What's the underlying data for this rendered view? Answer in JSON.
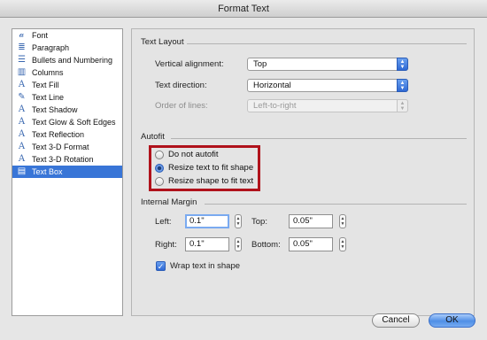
{
  "window": {
    "title": "Format Text"
  },
  "sidebar": {
    "items": [
      {
        "label": "Font",
        "icon": "font-icon",
        "glyph": "𝒶"
      },
      {
        "label": "Paragraph",
        "icon": "paragraph-icon",
        "glyph": "≣"
      },
      {
        "label": "Bullets and Numbering",
        "icon": "bullets-icon",
        "glyph": "☰"
      },
      {
        "label": "Columns",
        "icon": "columns-icon",
        "glyph": "▥"
      },
      {
        "label": "Text Fill",
        "icon": "text-fill-icon",
        "glyph": "A"
      },
      {
        "label": "Text Line",
        "icon": "text-line-icon",
        "glyph": "✎"
      },
      {
        "label": "Text Shadow",
        "icon": "text-shadow-icon",
        "glyph": "A"
      },
      {
        "label": "Text Glow & Soft Edges",
        "icon": "text-glow-icon",
        "glyph": "A"
      },
      {
        "label": "Text Reflection",
        "icon": "text-reflection-icon",
        "glyph": "A"
      },
      {
        "label": "Text 3-D Format",
        "icon": "text-3d-format-icon",
        "glyph": "A"
      },
      {
        "label": "Text 3-D Rotation",
        "icon": "text-3d-rotation-icon",
        "glyph": "A"
      },
      {
        "label": "Text Box",
        "icon": "text-box-icon",
        "glyph": "▤",
        "selected": true
      }
    ]
  },
  "text_layout": {
    "title": "Text Layout",
    "vertical_alignment_label": "Vertical alignment:",
    "vertical_alignment_value": "Top",
    "text_direction_label": "Text direction:",
    "text_direction_value": "Horizontal",
    "order_of_lines_label": "Order of lines:",
    "order_of_lines_value": "Left-to-right"
  },
  "autofit": {
    "title": "Autofit",
    "options": [
      {
        "label": "Do not autofit",
        "checked": false
      },
      {
        "label": "Resize text to fit shape",
        "checked": true
      },
      {
        "label": "Resize shape to fit text",
        "checked": false
      }
    ]
  },
  "internal_margin": {
    "title": "Internal Margin",
    "left_label": "Left:",
    "left_value": "0.1\"",
    "top_label": "Top:",
    "top_value": "0.05\"",
    "right_label": "Right:",
    "right_value": "0.1\"",
    "bottom_label": "Bottom:",
    "bottom_value": "0.05\"",
    "wrap_label": "Wrap text in shape",
    "wrap_checked": true
  },
  "buttons": {
    "cancel": "Cancel",
    "ok": "OK"
  },
  "colors": {
    "selection": "#3875d7",
    "highlight_border": "#b0121b",
    "default_button": "#4f8fe6"
  }
}
